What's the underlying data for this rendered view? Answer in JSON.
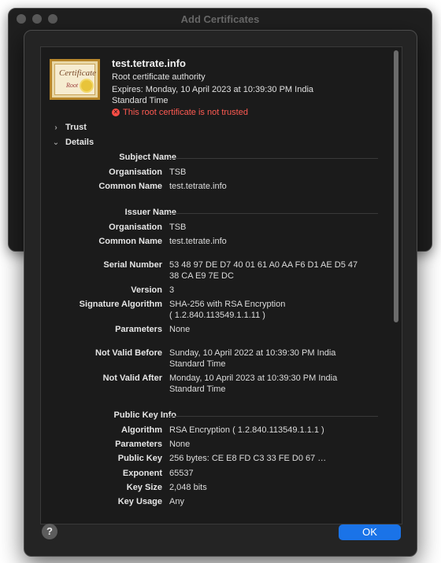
{
  "background_window": {
    "title": "Add Certificates"
  },
  "certificate": {
    "name": "test.tetrate.info",
    "type": "Root certificate authority",
    "expires_line1": "Expires: Monday, 10 April 2023 at 10:39:30 PM India",
    "expires_line2": "Standard Time",
    "status": "This root certificate is not trusted",
    "icon_text1": "Certificate",
    "icon_text2": "Root"
  },
  "sections": {
    "trust": "Trust",
    "details": "Details"
  },
  "subject": {
    "heading": "Subject Name",
    "org_label": "Organisation",
    "org_value": "TSB",
    "cn_label": "Common Name",
    "cn_value": "test.tetrate.info"
  },
  "issuer": {
    "heading": "Issuer Name",
    "org_label": "Organisation",
    "org_value": "TSB",
    "cn_label": "Common Name",
    "cn_value": "test.tetrate.info"
  },
  "serial": {
    "label": "Serial Number",
    "line1": "53 48 97 DE D7 40 01 61 A0 AA F6 D1 AE D5 47",
    "line2": "38 CA E9 7E DC"
  },
  "version": {
    "label": "Version",
    "value": "3"
  },
  "sigalg": {
    "label": "Signature Algorithm",
    "line1": "SHA-256 with RSA Encryption",
    "line2": "( 1.2.840.113549.1.1.11 )"
  },
  "params1": {
    "label": "Parameters",
    "value": "None"
  },
  "not_before": {
    "label": "Not Valid Before",
    "line1": "Sunday, 10 April 2022 at 10:39:30 PM India",
    "line2": "Standard Time"
  },
  "not_after": {
    "label": "Not Valid After",
    "line1": "Monday, 10 April 2023 at 10:39:30 PM India",
    "line2": "Standard Time"
  },
  "pubkey": {
    "heading": "Public Key Info",
    "alg_label": "Algorithm",
    "alg_value": "RSA Encryption ( 1.2.840.113549.1.1.1 )",
    "params_label": "Parameters",
    "params_value": "None",
    "key_label": "Public Key",
    "key_value": "256 bytes: CE E8 FD C3 33 FE D0 67 …",
    "exp_label": "Exponent",
    "exp_value": "65537",
    "size_label": "Key Size",
    "size_value": "2,048 bits",
    "usage_label": "Key Usage",
    "usage_value": "Any"
  },
  "buttons": {
    "help": "?",
    "ok": "OK"
  },
  "colors": {
    "accent": "#1a73e8",
    "error": "#ff5a52",
    "sheet_bg": "#242424"
  }
}
